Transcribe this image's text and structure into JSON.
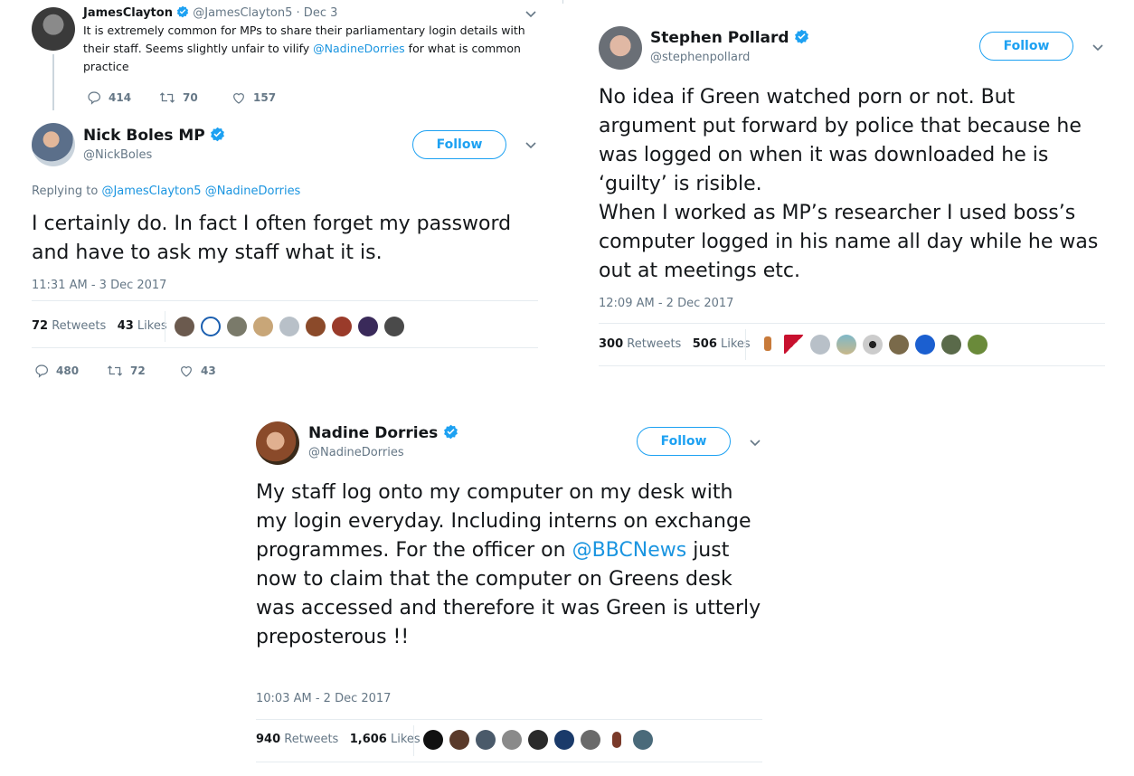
{
  "colors": {
    "link": "#1b95e0",
    "follow": "#1da1f2",
    "text": "#14171a",
    "muted": "#657786",
    "divider": "#e6ecf0"
  },
  "panel1": {
    "parent": {
      "name": "JamesClayton",
      "handle": "@JamesClayton5",
      "date": "· Dec 3",
      "text_before": "It is extremely common for MPs to share their parliamentary login details with their staff. Seems slightly unfair to vilify ",
      "mention": "@NadineDorries",
      "text_after": " for what is common practice",
      "replies": "414",
      "retweets": "70",
      "likes": "157"
    },
    "tweet": {
      "name": "Nick Boles MP",
      "handle": "@NickBoles",
      "follow_label": "Follow",
      "replying_label": "Replying to",
      "replying_mention_1": "@JamesClayton5",
      "replying_mention_2": "@NadineDorries",
      "text": "I certainly do. In fact I often forget my password and have to ask my staff what it is.",
      "timestamp": "11:31 AM - 3 Dec 2017",
      "retweets_count": "72",
      "retweets_label": "Retweets",
      "likes_count": "43",
      "likes_label": "Likes",
      "replies": "480",
      "retweets_action": "72",
      "likes_action": "43"
    }
  },
  "panel2": {
    "name": "Stephen Pollard",
    "handle": "@stephenpollard",
    "follow_label": "Follow",
    "text_line1": "No idea if Green watched porn or not. But argument put forward by police that because he was logged on when it was downloaded he is ‘guilty’ is risible.",
    "text_line2": "When I worked as MP’s researcher I used boss’s computer logged in his name all day while he was out at meetings etc.",
    "timestamp": "12:09 AM - 2 Dec 2017",
    "retweets_count": "300",
    "retweets_label": "Retweets",
    "likes_count": "506",
    "likes_label": "Likes"
  },
  "panel3": {
    "name": "Nadine Dorries",
    "handle": "@NadineDorries",
    "follow_label": "Follow",
    "text_before": "My staff log onto my computer on my desk with my login everyday. Including interns on exchange programmes. For the officer on ",
    "mention": "@BBCNews",
    "text_after": " just now to claim that the computer on Greens desk was accessed and therefore it was Green is utterly preposterous !!",
    "timestamp": "10:03 AM - 2 Dec 2017",
    "retweets_count": "940",
    "retweets_label": "Retweets",
    "likes_count": "1,606",
    "likes_label": "Likes"
  },
  "icons": [
    "verified-badge-icon",
    "chevron-down-icon",
    "reply-icon",
    "retweet-icon",
    "like-icon",
    "avatar"
  ]
}
